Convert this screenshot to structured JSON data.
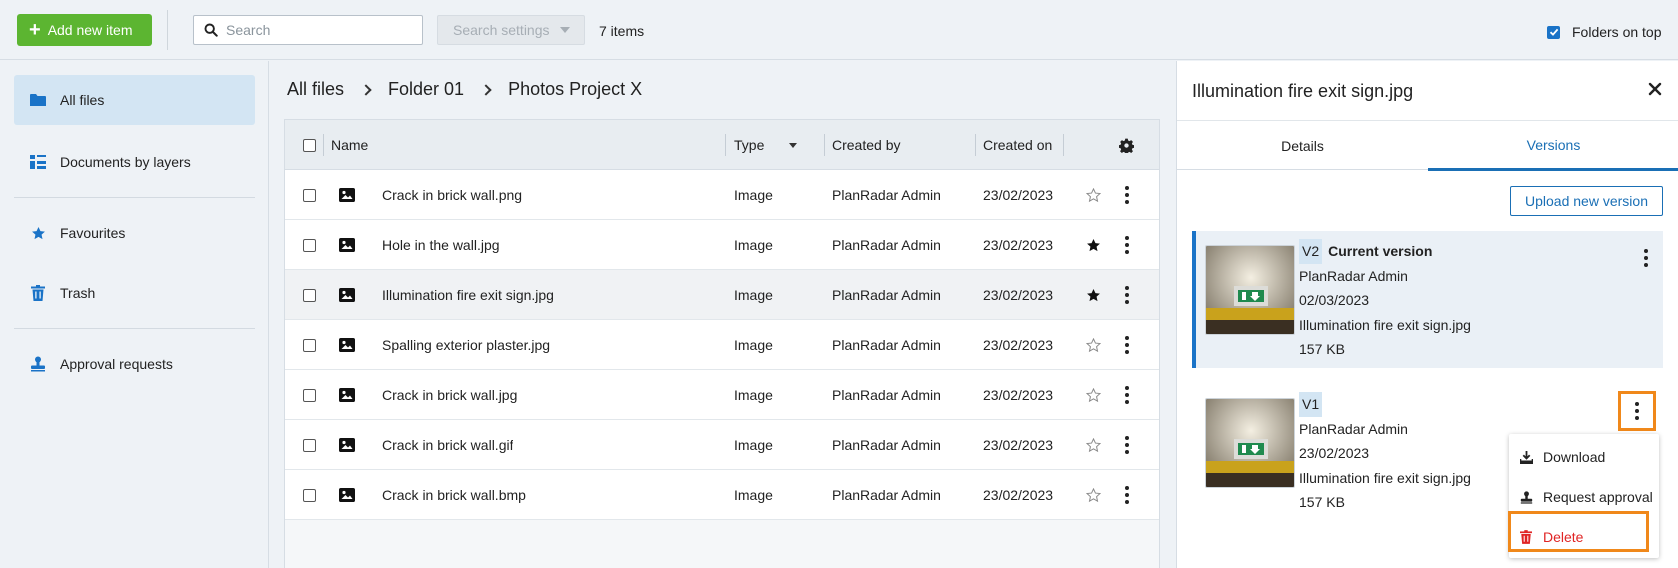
{
  "toolbar": {
    "add_label": "Add new item",
    "search_placeholder": "Search",
    "search_settings_label": "Search settings",
    "item_count": "7 items",
    "folders_on_top_label": "Folders on top",
    "folders_on_top_checked": true
  },
  "sidebar": {
    "items": [
      {
        "label": "All files",
        "icon": "folder-icon",
        "active": true
      },
      {
        "label": "Documents by layers",
        "icon": "layers-icon"
      },
      {
        "label": "Favourites",
        "icon": "star-icon"
      },
      {
        "label": "Trash",
        "icon": "trash-icon"
      },
      {
        "label": "Approval requests",
        "icon": "stamp-icon"
      }
    ]
  },
  "breadcrumb": [
    "All files",
    "Folder 01",
    "Photos Project X"
  ],
  "table": {
    "headers": {
      "name": "Name",
      "type": "Type",
      "created_by": "Created by",
      "created_on": "Created on"
    },
    "rows": [
      {
        "name": "Crack in brick wall.png",
        "type": "Image",
        "created_by": "PlanRadar Admin",
        "created_on": "23/02/2023",
        "favourite": false
      },
      {
        "name": "Hole in the wall.jpg",
        "type": "Image",
        "created_by": "PlanRadar Admin",
        "created_on": "23/02/2023",
        "favourite": true
      },
      {
        "name": "Illumination fire exit sign.jpg",
        "type": "Image",
        "created_by": "PlanRadar Admin",
        "created_on": "23/02/2023",
        "favourite": true,
        "selected": true
      },
      {
        "name": "Spalling exterior plaster.jpg",
        "type": "Image",
        "created_by": "PlanRadar Admin",
        "created_on": "23/02/2023",
        "favourite": false
      },
      {
        "name": "Crack in brick wall.jpg",
        "type": "Image",
        "created_by": "PlanRadar Admin",
        "created_on": "23/02/2023",
        "favourite": false
      },
      {
        "name": "Crack in brick wall.gif",
        "type": "Image",
        "created_by": "PlanRadar Admin",
        "created_on": "23/02/2023",
        "favourite": false
      },
      {
        "name": "Crack in brick wall.bmp",
        "type": "Image",
        "created_by": "PlanRadar Admin",
        "created_on": "23/02/2023",
        "favourite": false
      }
    ]
  },
  "panel": {
    "title": "Illumination fire exit sign.jpg",
    "tabs": [
      "Details",
      "Versions"
    ],
    "active_tab": "Versions",
    "upload_label": "Upload new version",
    "versions": [
      {
        "badge": "V2",
        "status": "Current version",
        "author": "PlanRadar Admin",
        "date": "02/03/2023",
        "filename": "Illumination fire exit sign.jpg",
        "size": "157 KB"
      },
      {
        "badge": "V1",
        "status": "",
        "author": "PlanRadar Admin",
        "date": "23/02/2023",
        "filename": "Illumination fire exit sign.jpg",
        "size": "157 KB"
      }
    ],
    "menu": [
      {
        "label": "Download",
        "icon": "download-icon"
      },
      {
        "label": "Request approval",
        "icon": "stamp-icon"
      },
      {
        "label": "Delete",
        "icon": "trash-icon",
        "danger": true
      }
    ]
  },
  "colors": {
    "accent": "#1a6fb5",
    "add_button": "#5cb531",
    "highlight": "#f0881a",
    "danger": "#e02424"
  }
}
